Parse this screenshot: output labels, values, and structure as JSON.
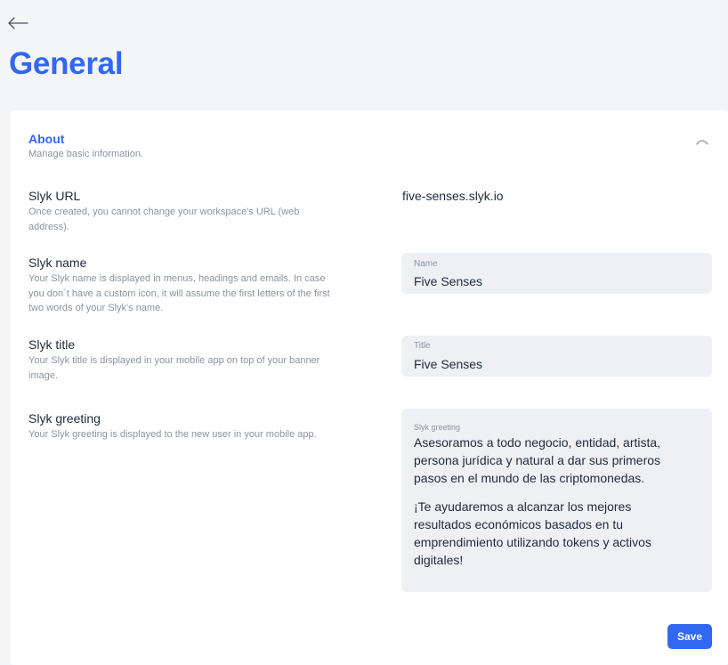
{
  "header": {
    "back_icon": "arrow-left-icon",
    "title": "General"
  },
  "about": {
    "title": "About",
    "subtitle": "Manage basic information.",
    "collapse_icon": "chevron-up-icon"
  },
  "fields": {
    "url": {
      "label": "Slyk URL",
      "description": "Once created, you cannot change your workspace's URL (web address).",
      "value": "five-senses.slyk.io"
    },
    "name": {
      "label": "Slyk name",
      "description": "Your Slyk name is displayed in menus, headings and emails. In case you don´t have a custom icon, it will assume the first letters of the first two words of your Slyk's name.",
      "input_label": "Name",
      "value": "Five Senses"
    },
    "title": {
      "label": "Slyk title",
      "description": "Your Slyk title is displayed in your mobile app on top of your banner image.",
      "input_label": "Title",
      "value": "Five Senses"
    },
    "greeting": {
      "label": "Slyk greeting",
      "description": "Your Slyk greeting is displayed to the new user in your mobile app.",
      "input_label": "Slyk greeting",
      "paragraph_1": "Asesoramos a todo negocio, entidad, artista, persona jurídica y natural a dar sus primeros pasos en el mundo de las criptomonedas.",
      "paragraph_2": "¡Te ayudaremos a alcanzar los mejores resultados económicos basados en tu emprendimiento utilizando tokens y activos digitales!"
    }
  },
  "actions": {
    "save_label": "Save"
  },
  "colors": {
    "accent": "#3267f0",
    "field_bg": "#eef0f3",
    "page_bg": "#f4f5f7"
  }
}
